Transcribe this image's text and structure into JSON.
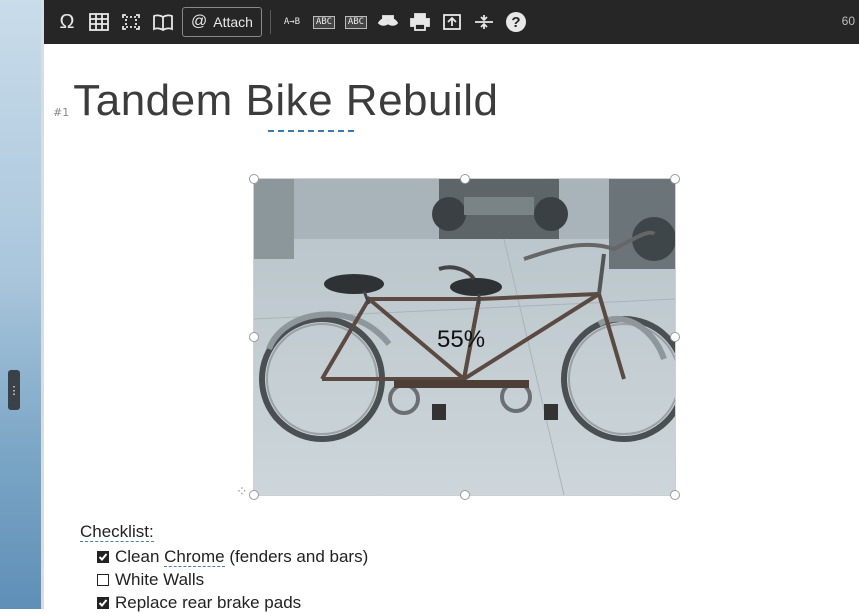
{
  "toolbar": {
    "attach_label": "Attach",
    "right_text": "60",
    "sort_label": "A→B",
    "spell_label_1": "ABC",
    "spell_label_2": "ABC"
  },
  "page": {
    "heading_marker": "#1",
    "title": "Tandem Bike Rebuild"
  },
  "image": {
    "zoom_text": "55%"
  },
  "checklist": {
    "title": "Checklist:",
    "items": [
      {
        "label_pre": "Clean ",
        "label_spell": "Chrome",
        "label_post": " (fenders and bars)",
        "checked": true
      },
      {
        "label": "White Walls",
        "checked": false
      },
      {
        "label": "Replace rear brake pads",
        "checked": true
      }
    ]
  },
  "colors": {
    "toolbar_bg": "#262626",
    "spell_underline": "#3a79b0"
  }
}
